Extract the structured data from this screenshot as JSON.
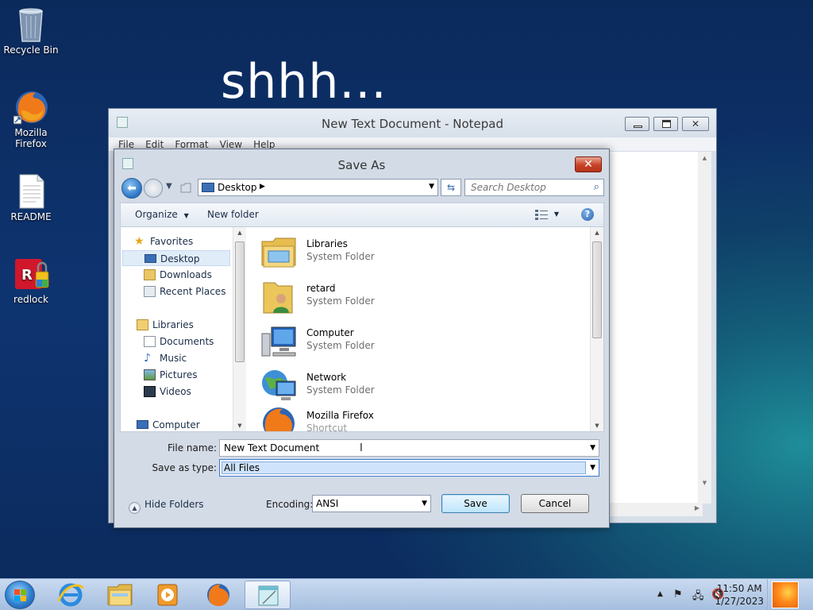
{
  "desktop": {
    "wallpaper_text": "shhh...",
    "icons": [
      {
        "label": "Recycle Bin",
        "icon": "recycle-bin-icon"
      },
      {
        "label": "Mozilla Firefox",
        "icon": "firefox-icon"
      },
      {
        "label": "README",
        "icon": "text-file-icon"
      },
      {
        "label": "redlock",
        "icon": "redlock-icon"
      }
    ]
  },
  "notepad": {
    "title": "New Text Document - Notepad",
    "menu": [
      "File",
      "Edit",
      "Format",
      "View",
      "Help"
    ]
  },
  "save_dialog": {
    "title": "Save As",
    "address": {
      "location": "Desktop"
    },
    "search": {
      "placeholder": "Search Desktop"
    },
    "toolbar": {
      "organize_label": "Organize",
      "new_folder_label": "New folder"
    },
    "navigation": {
      "favorites_header": "Favorites",
      "favorites": [
        "Desktop",
        "Downloads",
        "Recent Places"
      ],
      "selected": "Desktop",
      "libraries_header": "Libraries",
      "libraries": [
        "Documents",
        "Music",
        "Pictures",
        "Videos"
      ],
      "computer_header": "Computer"
    },
    "files": [
      {
        "name": "Libraries",
        "type": "System Folder",
        "icon": "libraries-folder-icon"
      },
      {
        "name": "retard",
        "type": "System Folder",
        "icon": "user-folder-icon"
      },
      {
        "name": "Computer",
        "type": "System Folder",
        "icon": "computer-icon"
      },
      {
        "name": "Network",
        "type": "System Folder",
        "icon": "network-icon"
      },
      {
        "name": "Mozilla Firefox",
        "type": "Shortcut",
        "icon": "firefox-icon"
      }
    ],
    "file_name_label": "File name:",
    "file_name_value": "New Text Document",
    "save_as_type_label": "Save as type:",
    "save_as_type_value": "All Files",
    "hide_folders_label": "Hide Folders",
    "encoding_label": "Encoding:",
    "encoding_value": "ANSI",
    "save_label": "Save",
    "cancel_label": "Cancel"
  },
  "taskbar": {
    "apps": [
      "internet-explorer-icon",
      "windows-explorer-icon",
      "media-player-icon",
      "firefox-icon",
      "notepad-icon"
    ],
    "active_app": "notepad-icon",
    "clock_time": "11:50 AM",
    "clock_date": "1/27/2023"
  },
  "colors": {
    "desktop_bg": "#0e3470",
    "taskbar_bg": "#b8cce8",
    "close_button": "#c84326",
    "selection": "#cfe4fa"
  }
}
